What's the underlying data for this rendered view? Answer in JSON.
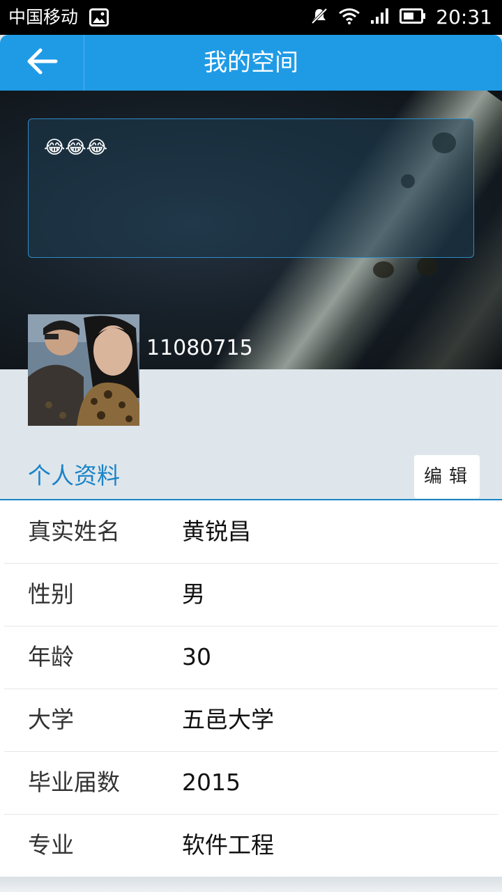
{
  "status_bar": {
    "carrier": "中国移动",
    "time": "20:31",
    "icons": [
      "gallery-icon",
      "mute-icon",
      "wifi-icon",
      "signal-icon",
      "battery-icon"
    ]
  },
  "app_bar": {
    "title": "我的空间",
    "color": "#1f9be6"
  },
  "cover": {
    "status_text": "😂😂😂",
    "username": "11080715"
  },
  "profile": {
    "section_title": "个人资料",
    "edit_label": "编辑",
    "accent_color": "#1a84c7",
    "rows": [
      {
        "label": "真实姓名",
        "value": "黄锐昌"
      },
      {
        "label": "性别",
        "value": "男"
      },
      {
        "label": "年龄",
        "value": "30"
      },
      {
        "label": "大学",
        "value": "五邑大学"
      },
      {
        "label": "毕业届数",
        "value": "2015"
      },
      {
        "label": "专业",
        "value": "软件工程"
      }
    ]
  }
}
